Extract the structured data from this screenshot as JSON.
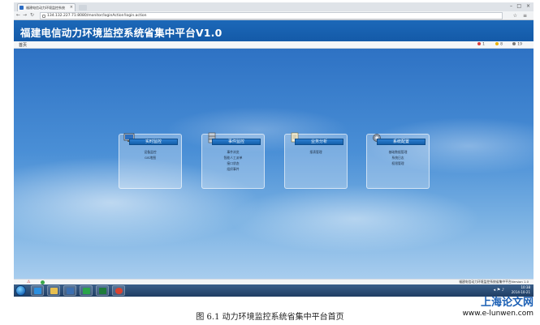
{
  "browser": {
    "tab_title": "福建电信动力环境监控系统",
    "url": "134.132.227.71:8080/monitor/loginAction!login.action"
  },
  "app": {
    "title": "福建电信动力环境监控系统省集中平台V1.0",
    "home_label": "首页",
    "alarms": [
      {
        "count": "1",
        "color": "#d83b3b"
      },
      {
        "count": "8",
        "color": "#e8b000"
      },
      {
        "count": "19",
        "color": "#7a7a7a"
      }
    ]
  },
  "panels": [
    {
      "title": "实时监控",
      "icon": "monitor-icon",
      "items": [
        "设备监控",
        "GIS地图"
      ]
    },
    {
      "title": "事件监控",
      "icon": "server-icon",
      "items": [
        "事件浏览",
        "智能人工派单",
        "接口状态",
        "组织事件"
      ]
    },
    {
      "title": "业务分析",
      "icon": "document-icon",
      "items": [
        "报表管理"
      ]
    },
    {
      "title": "系统配置",
      "icon": "gear-icon",
      "items": [
        "基础数据管理",
        "系统日志",
        "权限管理"
      ]
    }
  ],
  "footer": {
    "text": "福建电信动力环境监控系统省集中平台Version 1.0"
  },
  "taskbar": {
    "time": "10:38",
    "date": "2014-10-21",
    "buttons": [
      {
        "name": "ie-taskbar-button",
        "color": "#2b8fe0"
      },
      {
        "name": "folder-taskbar-button",
        "color": "#e8c050"
      },
      {
        "name": "media-taskbar-button",
        "color": "#3c6fb0"
      },
      {
        "name": "qq-taskbar-button",
        "color": "#2aa44a"
      },
      {
        "name": "excel-taskbar-button",
        "color": "#1e7b3a"
      },
      {
        "name": "chrome-taskbar-button",
        "color": "#d9412f"
      }
    ]
  },
  "caption": "图 6.1 动力环境监控系统省集中平台首页",
  "watermark": {
    "cn": "上海论文网",
    "url": "www.e-lunwen.com"
  }
}
